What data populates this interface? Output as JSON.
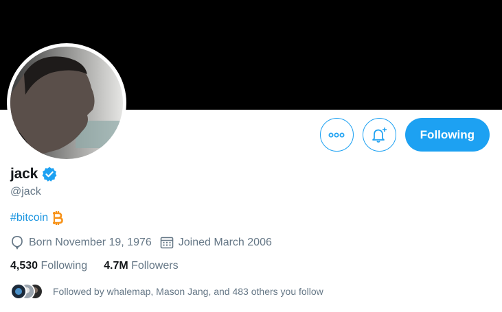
{
  "profile": {
    "name": "jack",
    "handle": "@jack",
    "verified_icon": "verified-badge-icon",
    "bio": {
      "hashtag": "#bitcoin",
      "emoji_icon": "bitcoin-icon"
    },
    "birthday": "Born November 19, 1976",
    "joined": "Joined March 2006",
    "following_count": "4,530",
    "following_label": "Following",
    "followers_count": "4.7M",
    "followers_label": "Followers",
    "followed_by": "Followed by whalemap, Mason Jang, and 483 others you follow"
  },
  "actions": {
    "more_icon": "more-icon",
    "notifications_icon": "bell-plus-icon",
    "follow_label": "Following"
  },
  "colors": {
    "accent": "#1da1f2",
    "link": "#1b95e0",
    "muted": "#657786",
    "banner": "#000000",
    "bitcoin": "#f7931a"
  }
}
